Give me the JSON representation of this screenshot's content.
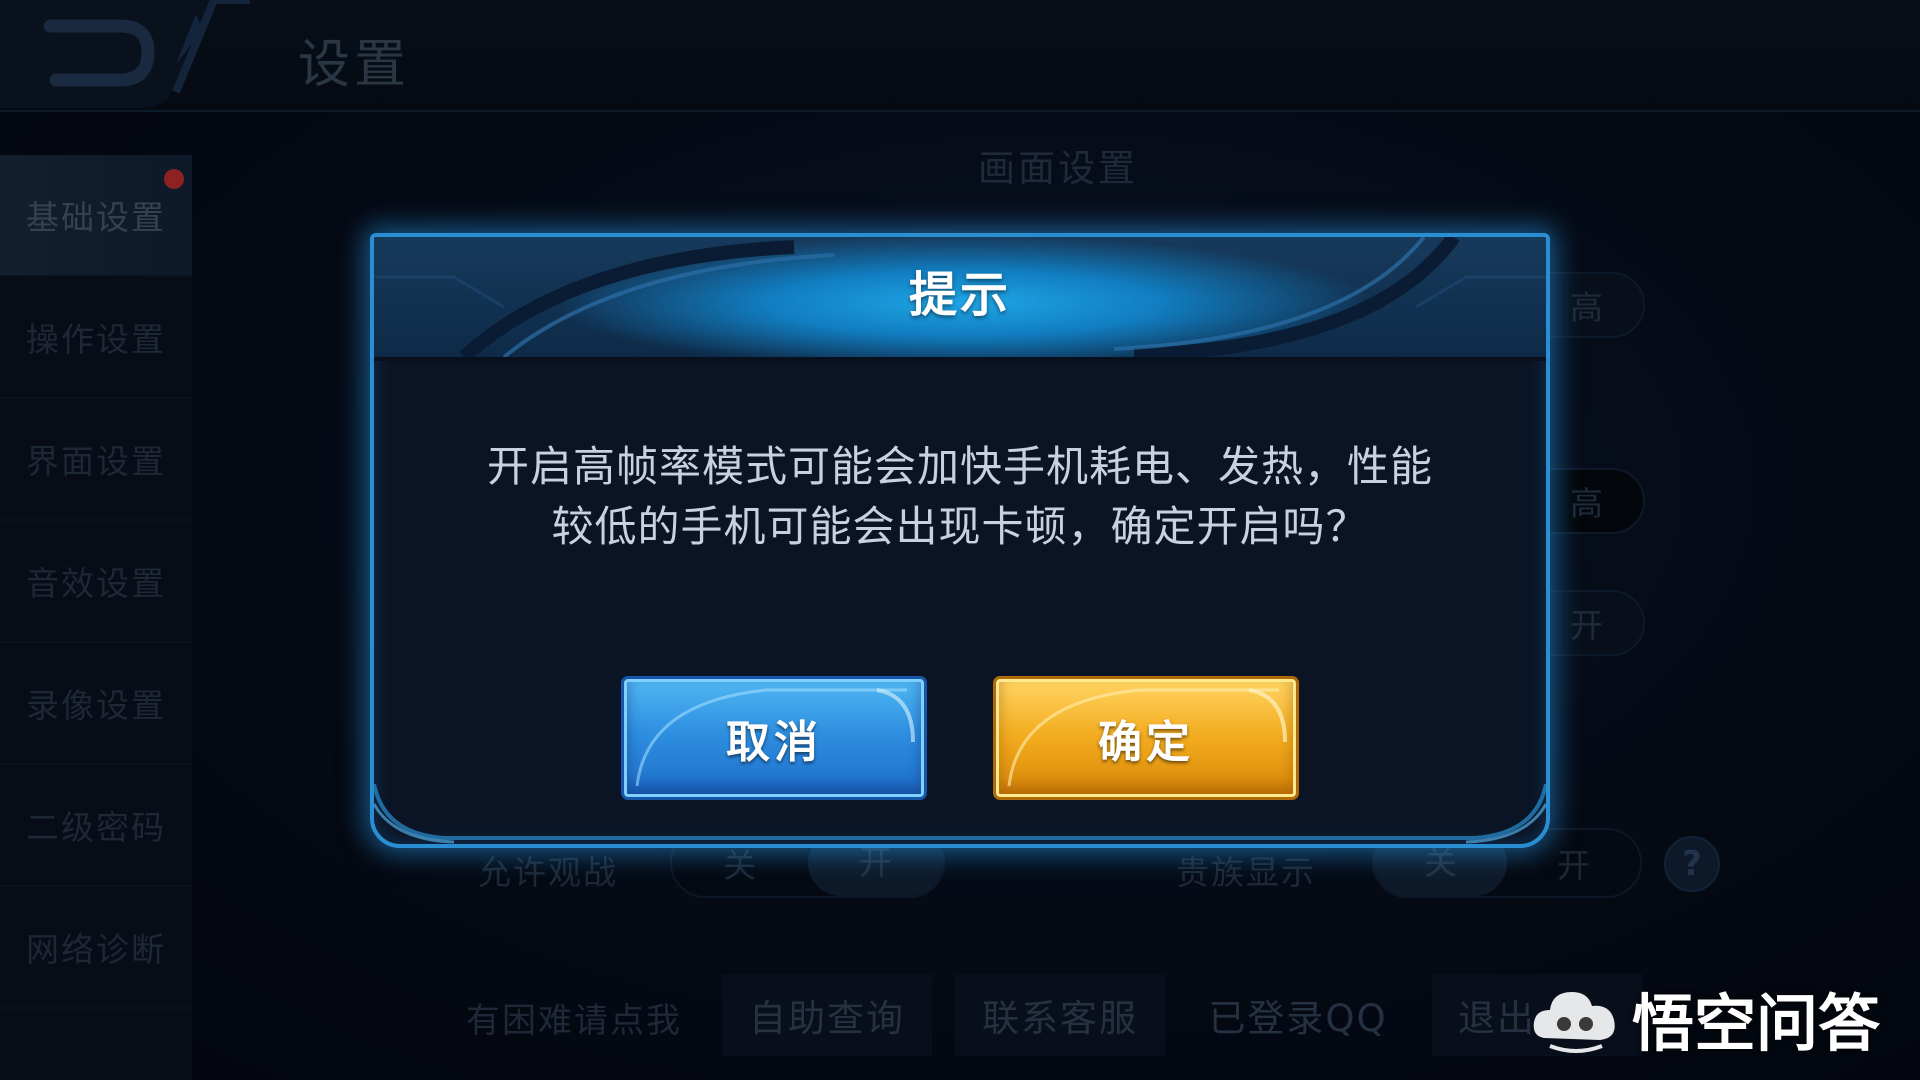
{
  "page": {
    "title": "设置"
  },
  "sidebar": {
    "items": [
      {
        "label": "基础设置",
        "active": true,
        "has_dot": true
      },
      {
        "label": "操作设置"
      },
      {
        "label": "界面设置"
      },
      {
        "label": "音效设置"
      },
      {
        "label": "录像设置"
      },
      {
        "label": "二级密码"
      },
      {
        "label": "网络诊断"
      }
    ]
  },
  "main": {
    "section_title": "画面设置",
    "quality_options": [
      "高",
      "高",
      "开"
    ],
    "allow_spectate": {
      "label": "允许观战",
      "off": "关",
      "on": "开"
    },
    "noble_display": {
      "label": "贵族显示",
      "off": "关",
      "on": "开"
    }
  },
  "footer": {
    "hint": "有困难请点我",
    "self_help": "自助查询",
    "contact": "联系客服",
    "logged_in": "已登录QQ",
    "logout": "退出"
  },
  "dialog": {
    "title": "提示",
    "message_line1": "开启高帧率模式可能会加快手机耗电、发热，性能",
    "message_line2": "较低的手机可能会出现卡顿，确定开启吗？",
    "cancel_label": "取消",
    "confirm_label": "确定"
  },
  "watermark": {
    "text": "悟空问答"
  },
  "colors": {
    "accent": "#2a8fd2",
    "cancel": "#2e8fe0",
    "confirm": "#f3ac1f"
  }
}
